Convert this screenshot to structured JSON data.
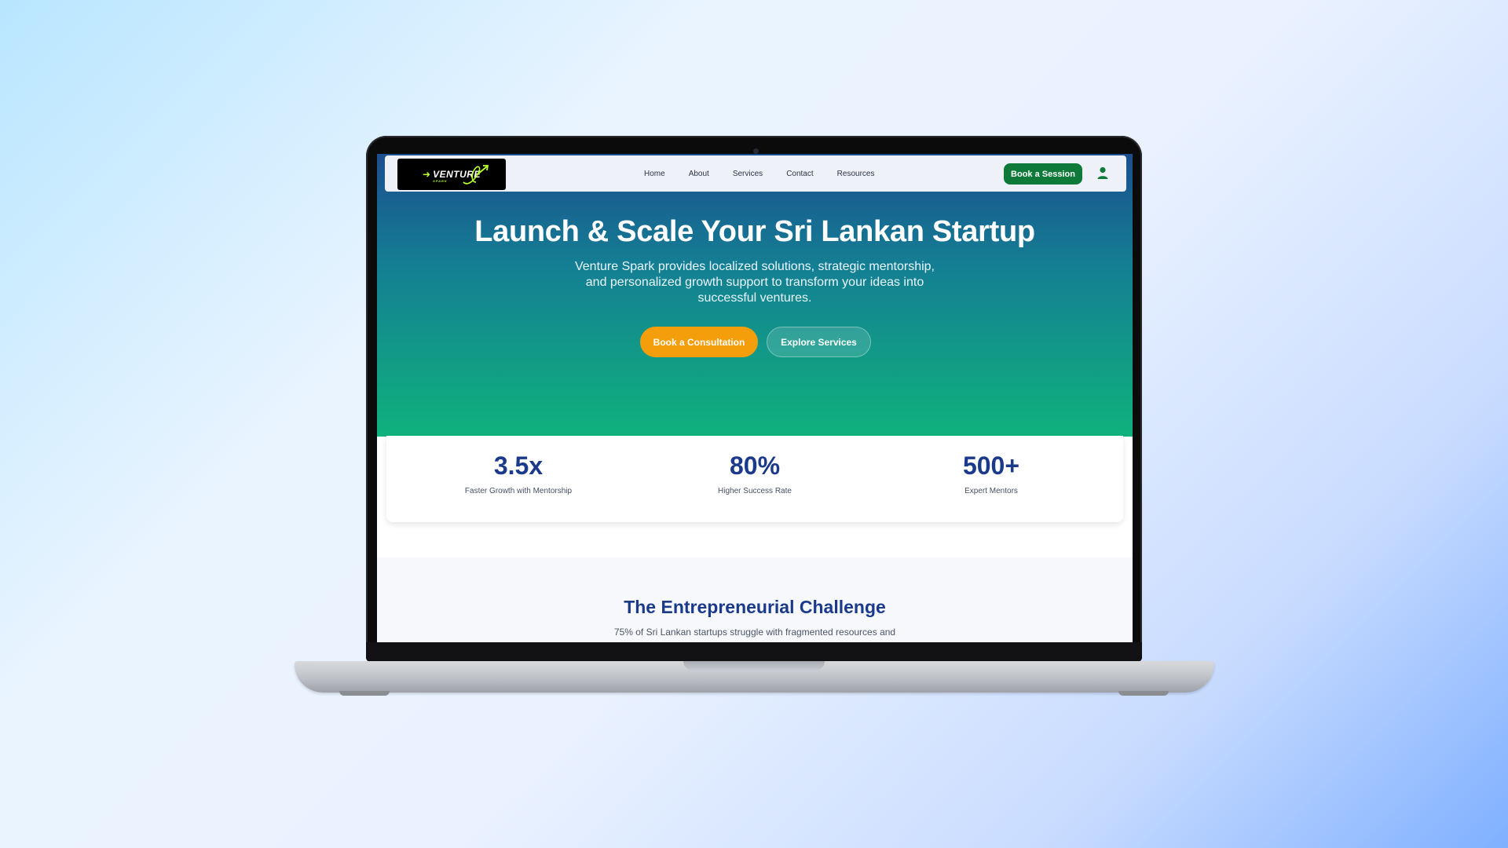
{
  "nav": {
    "logo_text": "VENTURE",
    "logo_sub": "SPARK",
    "links": [
      "Home",
      "About",
      "Services",
      "Contact",
      "Resources"
    ],
    "cta": "Book a Session"
  },
  "hero": {
    "title": "Launch & Scale Your Sri Lankan Startup",
    "subtitle": "Venture Spark provides localized solutions, strategic mentorship, and personalized growth support to transform your ideas into successful ventures.",
    "primary_button": "Book a Consultation",
    "secondary_button": "Explore Services"
  },
  "stats": [
    {
      "value": "3.5x",
      "label": "Faster Growth with Mentorship"
    },
    {
      "value": "80%",
      "label": "Higher Success Rate"
    },
    {
      "value": "500+",
      "label": "Expert Mentors"
    }
  ],
  "challenge": {
    "title": "The Entrepreneurial Challenge",
    "subtitle": "75% of Sri Lankan startups struggle with fragmented resources and"
  },
  "colors": {
    "hero_top": "#1b4f8f",
    "hero_bottom": "#0fb27c",
    "accent_orange": "#f59e0b",
    "accent_green": "#0d7a3a",
    "stat_blue": "#1b3a8a"
  }
}
